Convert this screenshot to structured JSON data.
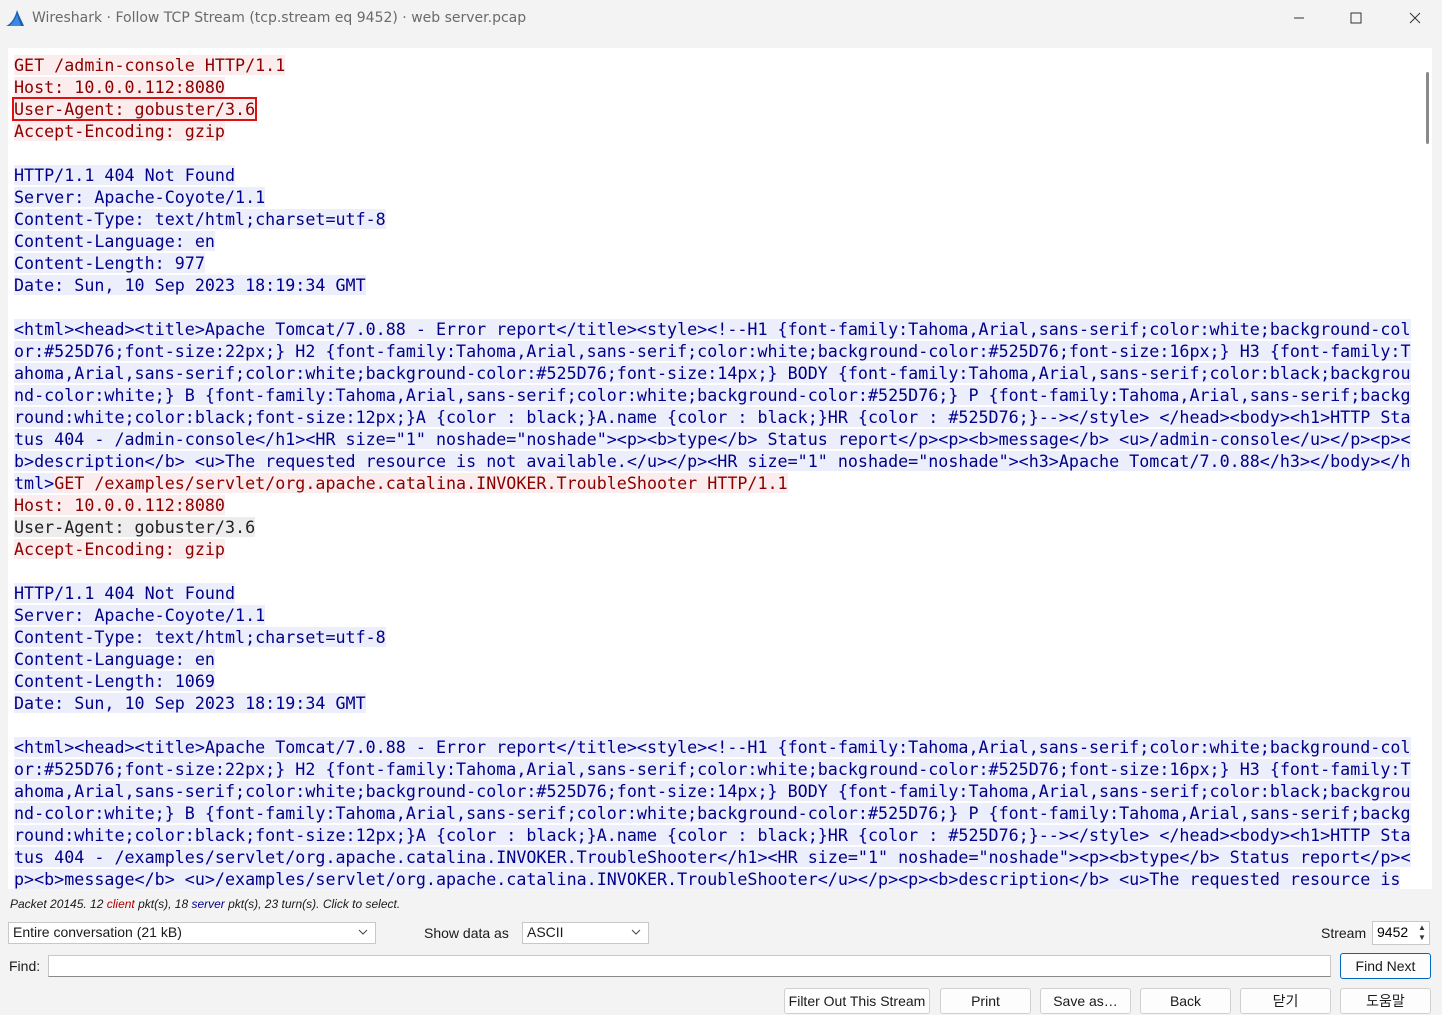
{
  "window": {
    "title": "Wireshark · Follow TCP Stream (tcp.stream eq 9452) · web server.pcap"
  },
  "stream": {
    "lines": [
      {
        "type": "client",
        "text": "GET /admin-console HTTP/1.1"
      },
      {
        "type": "client",
        "text": "Host: 10.0.0.112:8080"
      },
      {
        "type": "client",
        "text": "User-Agent: gobuster/3.6",
        "highlight": true
      },
      {
        "type": "client",
        "text": "Accept-Encoding: gzip"
      },
      {
        "type": "blank",
        "text": ""
      },
      {
        "type": "server",
        "text": "HTTP/1.1 404 Not Found"
      },
      {
        "type": "server",
        "text": "Server: Apache-Coyote/1.1"
      },
      {
        "type": "server",
        "text": "Content-Type: text/html;charset=utf-8"
      },
      {
        "type": "server",
        "text": "Content-Language: en"
      },
      {
        "type": "server",
        "text": "Content-Length: 977"
      },
      {
        "type": "server",
        "text": "Date: Sun, 10 Sep 2023 18:19:34 GMT"
      },
      {
        "type": "blank",
        "text": ""
      },
      {
        "type": "server",
        "text": "<html><head><title>Apache Tomcat/7.0.88 - Error report</title><style><!--H1 {font-family:Tahoma,Arial,sans-serif;color:white;background-col"
      },
      {
        "type": "server",
        "text": "or:#525D76;font-size:22px;} H2 {font-family:Tahoma,Arial,sans-serif;color:white;background-color:#525D76;font-size:16px;} H3 {font-family:T"
      },
      {
        "type": "server",
        "text": "ahoma,Arial,sans-serif;color:white;background-color:#525D76;font-size:14px;} BODY {font-family:Tahoma,Arial,sans-serif;color:black;backgrou"
      },
      {
        "type": "server",
        "text": "nd-color:white;} B {font-family:Tahoma,Arial,sans-serif;color:white;background-color:#525D76;} P {font-family:Tahoma,Arial,sans-serif;backg"
      },
      {
        "type": "server",
        "text": "round:white;color:black;font-size:12px;}A {color : black;}A.name {color : black;}HR {color : #525D76;}--></style> </head><body><h1>HTTP Sta"
      },
      {
        "type": "server",
        "text": "tus 404 - /admin-console</h1><HR size=\"1\" noshade=\"noshade\"><p><b>type</b> Status report</p><p><b>message</b> <u>/admin-console</u></p><p><"
      },
      {
        "type": "server",
        "text": "b>description</b> <u>The requested resource is not available.</u></p><HR size=\"1\" noshade=\"noshade\"><h3>Apache Tomcat/7.0.88</h3></body></h"
      },
      {
        "type": "mixed",
        "server": "tml>",
        "client": "GET /examples/servlet/org.apache.catalina.INVOKER.TroubleShooter HTTP/1.1"
      },
      {
        "type": "client",
        "text": "Host: 10.0.0.112:8080"
      },
      {
        "type": "plain",
        "text": "User-Agent: gobuster/3.6"
      },
      {
        "type": "client",
        "text": "Accept-Encoding: gzip"
      },
      {
        "type": "blank",
        "text": ""
      },
      {
        "type": "server",
        "text": "HTTP/1.1 404 Not Found"
      },
      {
        "type": "server",
        "text": "Server: Apache-Coyote/1.1"
      },
      {
        "type": "server",
        "text": "Content-Type: text/html;charset=utf-8"
      },
      {
        "type": "server",
        "text": "Content-Language: en"
      },
      {
        "type": "server",
        "text": "Content-Length: 1069"
      },
      {
        "type": "server",
        "text": "Date: Sun, 10 Sep 2023 18:19:34 GMT"
      },
      {
        "type": "blank",
        "text": ""
      },
      {
        "type": "server",
        "text": "<html><head><title>Apache Tomcat/7.0.88 - Error report</title><style><!--H1 {font-family:Tahoma,Arial,sans-serif;color:white;background-col"
      },
      {
        "type": "server",
        "text": "or:#525D76;font-size:22px;} H2 {font-family:Tahoma,Arial,sans-serif;color:white;background-color:#525D76;font-size:16px;} H3 {font-family:T"
      },
      {
        "type": "server",
        "text": "ahoma,Arial,sans-serif;color:white;background-color:#525D76;font-size:14px;} BODY {font-family:Tahoma,Arial,sans-serif;color:black;backgrou"
      },
      {
        "type": "server",
        "text": "nd-color:white;} B {font-family:Tahoma,Arial,sans-serif;color:white;background-color:#525D76;} P {font-family:Tahoma,Arial,sans-serif;backg"
      },
      {
        "type": "server",
        "text": "round:white;color:black;font-size:12px;}A {color : black;}A.name {color : black;}HR {color : #525D76;}--></style> </head><body><h1>HTTP Sta"
      },
      {
        "type": "server",
        "text": "tus 404 - /examples/servlet/org.apache.catalina.INVOKER.TroubleShooter</h1><HR size=\"1\" noshade=\"noshade\"><p><b>type</b> Status report</p><"
      },
      {
        "type": "server",
        "text": "p><b>message</b> <u>/examples/servlet/org.apache.catalina.INVOKER.TroubleShooter</u></p><p><b>description</b> <u>The requested resource is"
      }
    ]
  },
  "status": {
    "prefix": "Packet 20145. 12 ",
    "client_word": "client",
    "middle": " pkt(s), 18 ",
    "server_word": "server",
    "suffix": " pkt(s), 23 turn(s). Click to select."
  },
  "controls": {
    "conversation_select": "Entire conversation (21 kB)",
    "show_data_label": "Show data as",
    "show_data_value": "ASCII",
    "stream_label": "Stream",
    "stream_value": "9452",
    "find_label": "Find:",
    "find_value": "",
    "find_next": "Find Next"
  },
  "buttons": {
    "filter_out": "Filter Out This Stream",
    "print": "Print",
    "save_as": "Save as…",
    "back": "Back",
    "close": "닫기",
    "help": "도움말"
  },
  "colors": {
    "client_fg": "#8b0000",
    "client_bg": "#fbeded",
    "server_fg": "#00008b",
    "server_bg": "#edeefb",
    "highlight_outline": "#e01010"
  }
}
